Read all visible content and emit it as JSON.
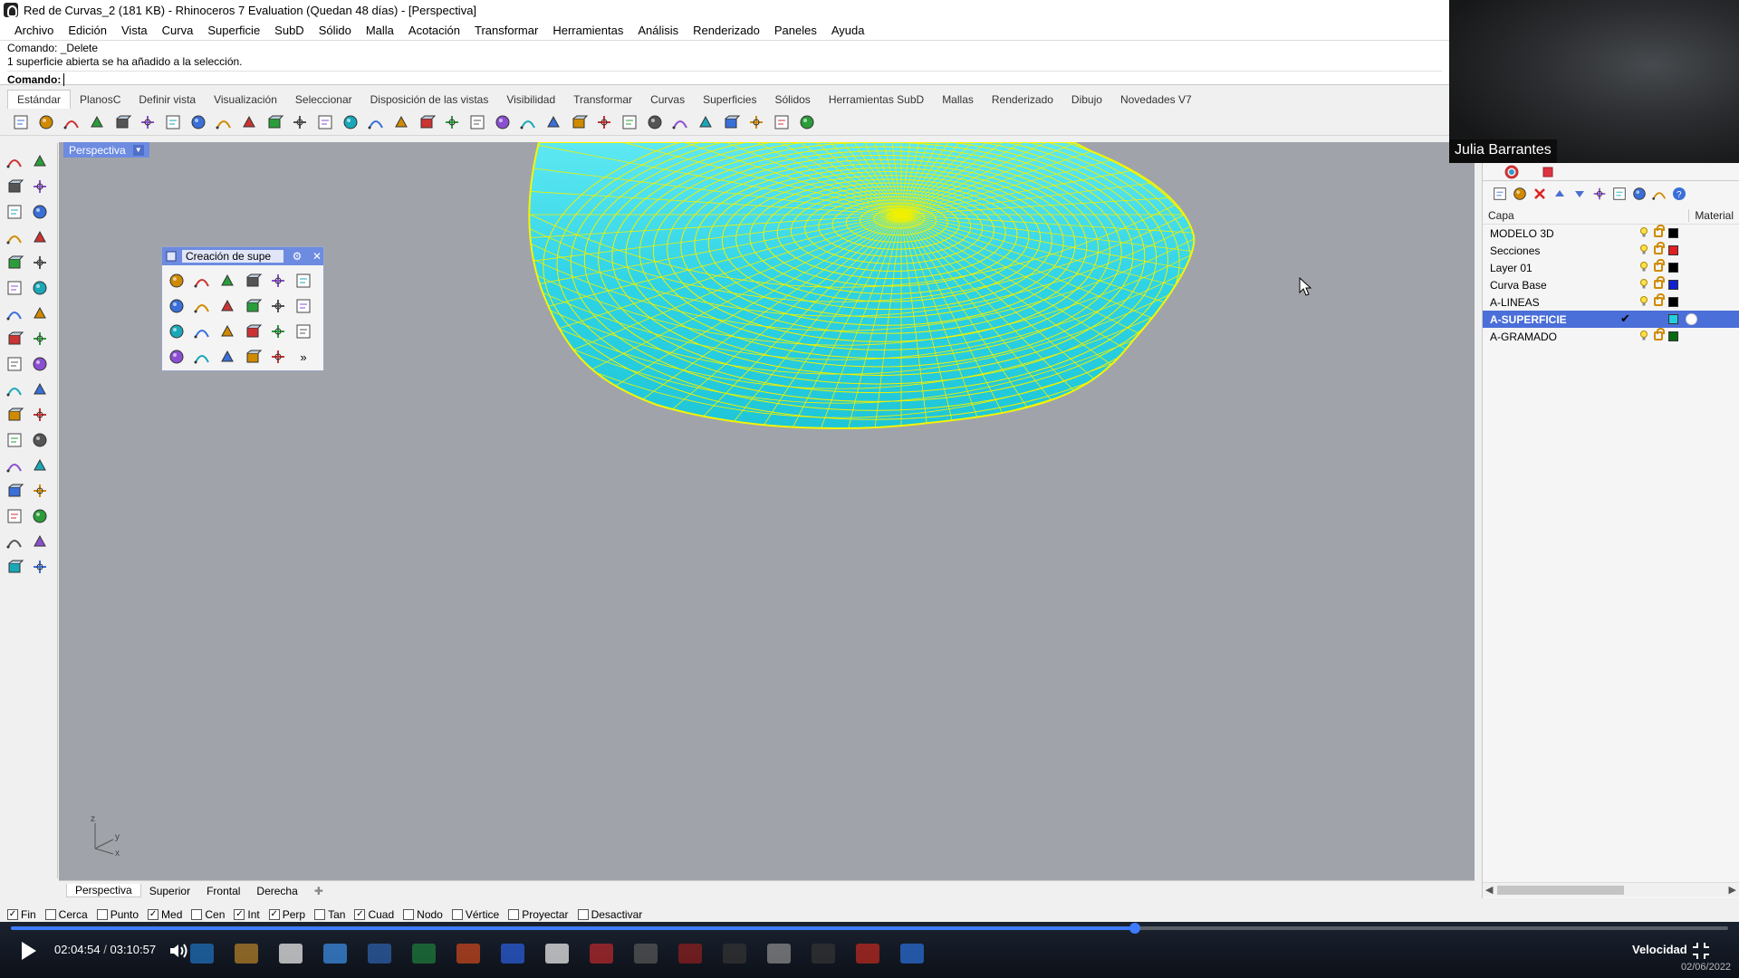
{
  "window": {
    "title": "Red de Curvas_2 (181 KB) - Rhinoceros 7 Evaluation (Quedan 48 días) - [Perspectiva]"
  },
  "menu": [
    "Archivo",
    "Edición",
    "Vista",
    "Curva",
    "Superficie",
    "SubD",
    "Sólido",
    "Malla",
    "Acotación",
    "Transformar",
    "Herramientas",
    "Análisis",
    "Renderizado",
    "Paneles",
    "Ayuda"
  ],
  "command": {
    "history": [
      "Comando: _Delete",
      "1 superficie abierta se ha añadido a la selección."
    ],
    "prompt_label": "Comando:",
    "value": ""
  },
  "toolbar_tabs": [
    "Estándar",
    "PlanosC",
    "Definir vista",
    "Visualización",
    "Seleccionar",
    "Disposición de las vistas",
    "Visibilidad",
    "Transformar",
    "Curvas",
    "Superficies",
    "Sólidos",
    "Herramientas SubD",
    "Mallas",
    "Renderizado",
    "Dibujo",
    "Novedades V7"
  ],
  "toolbar_icons": [
    "new-file-icon",
    "open-folder-icon",
    "save-icon",
    "print-icon",
    "export-icon",
    "copy-icon",
    "paste-icon",
    "clipboard-icon",
    "undo-icon",
    "pan-hand-icon",
    "rotate-view-icon",
    "zoom-icon",
    "zoom-window-icon",
    "zoom-extents-icon",
    "zoom-selected-icon",
    "zoom-dynamic-icon",
    "four-viewports-icon",
    "rotate-camera-icon",
    "car-render-icon",
    "focus-icon",
    "bulb-icon",
    "lock-icon",
    "layer-icon",
    "color-wheel-icon",
    "shade-sphere-icon",
    "render-sphere-icon",
    "material-sphere-icon",
    "filter-icon",
    "options-gear-icon",
    "grid-snap-icon",
    "globe-icon",
    "help-icon"
  ],
  "left_tools": [
    "select-arrow-icon",
    "point-icon",
    "polyline-icon",
    "curve-edit-icon",
    "circle-icon",
    "ellipse-icon",
    "triangle-icon",
    "rectangle-icon",
    "polygon-icon",
    "arc-icon",
    "surface-icon",
    "curve-surface-icon",
    "box-solid-icon",
    "sphere-solid-icon",
    "cylinder-icon",
    "mesh-icon",
    "explode-icon",
    "spark-icon",
    "move-icon",
    "align-icon",
    "boolean-icon",
    "group-icon",
    "fillet-icon",
    "offset-icon",
    "text-icon",
    "scale-icon",
    "array-icon",
    "mirror-icon",
    "grid-array-icon",
    "gumball-icon",
    "analyze-icon",
    "check-icon",
    "zebra-icon",
    "paint-icon"
  ],
  "viewport": {
    "label": "Perspectiva",
    "axes": [
      "z",
      "y",
      "x"
    ]
  },
  "floating_toolbox": {
    "title": "Creación de supe",
    "icons": [
      "surface-from-points-icon",
      "sphere-surface-icon",
      "patch-icon",
      "loft-icon",
      "plane-icon",
      "sweep-icon",
      "rectangle-surface-icon",
      "edge-surface-icon",
      "extrude-surface-icon",
      "revolve-icon",
      "rail-revolve-icon",
      "network-icon",
      "cube-surface-icon",
      "extrude-straight-icon",
      "tent-surface-icon",
      "cone-icon",
      "sweep1-icon",
      "torus-icon",
      "blend-icon",
      "sweep-one-icon",
      "sweep-two-icon",
      "tube-icon",
      "drape-icon",
      "more-icon"
    ]
  },
  "viewport_tabs": [
    "Perspectiva",
    "Superior",
    "Frontal",
    "Derecha"
  ],
  "osnaps": [
    {
      "label": "Fin",
      "checked": true
    },
    {
      "label": "Cerca",
      "checked": false
    },
    {
      "label": "Punto",
      "checked": false
    },
    {
      "label": "Med",
      "checked": true
    },
    {
      "label": "Cen",
      "checked": false
    },
    {
      "label": "Int",
      "checked": true
    },
    {
      "label": "Perp",
      "checked": true
    },
    {
      "label": "Tan",
      "checked": false
    },
    {
      "label": "Cuad",
      "checked": true
    },
    {
      "label": "Nodo",
      "checked": false
    },
    {
      "label": "Vértice",
      "checked": false
    },
    {
      "label": "Proyectar",
      "checked": false
    },
    {
      "label": "Desactivar",
      "checked": false
    }
  ],
  "layers_panel": {
    "col_layer": "Capa",
    "col_material": "Material",
    "layers": [
      {
        "name": "MODELO 3D",
        "color": "#000000",
        "active": false
      },
      {
        "name": "Secciones",
        "color": "#e02020",
        "active": false
      },
      {
        "name": "Layer 01",
        "color": "#000000",
        "active": false
      },
      {
        "name": "Curva Base",
        "color": "#1020d0",
        "active": false
      },
      {
        "name": "A-LINEAS",
        "color": "#000000",
        "active": false
      },
      {
        "name": "A-SUPERFICIE",
        "color": "#20d0e0",
        "active": true
      },
      {
        "name": "A-GRAMADO",
        "color": "#0a6a10",
        "active": false
      }
    ]
  },
  "webcam": {
    "name": "Julia Barrantes"
  },
  "video": {
    "current": "02:04:54",
    "separator": "/",
    "total": "03:10:57",
    "progress": 0.6545,
    "speed_label": "Velocidad",
    "date": "02/06/2022"
  },
  "colors": {
    "surface": "#30d8e8",
    "isocurve": "#f0f000",
    "viewport_bg": "#a0a4aa",
    "active": "#4b6fd8"
  }
}
